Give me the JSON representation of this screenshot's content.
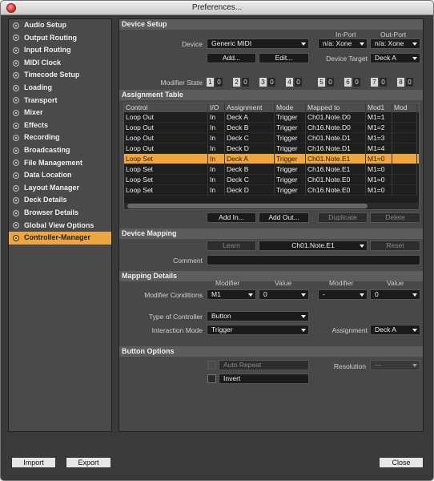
{
  "window": {
    "title": "Preferences..."
  },
  "sidebar": {
    "items": [
      {
        "label": "Audio Setup"
      },
      {
        "label": "Output Routing"
      },
      {
        "label": "Input Routing"
      },
      {
        "label": "MIDI Clock"
      },
      {
        "label": "Timecode Setup"
      },
      {
        "label": "Loading"
      },
      {
        "label": "Transport"
      },
      {
        "label": "Mixer"
      },
      {
        "label": "Effects"
      },
      {
        "label": "Recording"
      },
      {
        "label": "Broadcasting"
      },
      {
        "label": "File Management"
      },
      {
        "label": "Data Location"
      },
      {
        "label": "Layout Manager"
      },
      {
        "label": "Deck Details"
      },
      {
        "label": "Browser Details"
      },
      {
        "label": "Global View Options"
      },
      {
        "label": "Controller-Manager"
      }
    ],
    "active_label": "Controller-Manager"
  },
  "device_setup": {
    "header": "Device Setup",
    "device_label": "Device",
    "device_value": "Generic MIDI",
    "in_port_label": "In-Port",
    "in_port_value": "n/a: Xone",
    "out_port_label": "Out-Port",
    "out_port_value": "n/a: Xone",
    "add_label": "Add...",
    "edit_label": "Edit...",
    "device_target_label": "Device Target",
    "device_target_value": "Deck A",
    "modifier_state_label": "Modifier State",
    "modifiers": [
      {
        "num": "1",
        "val": "0"
      },
      {
        "num": "2",
        "val": "0"
      },
      {
        "num": "3",
        "val": "0"
      },
      {
        "num": "4",
        "val": "0"
      },
      {
        "num": "5",
        "val": "0"
      },
      {
        "num": "6",
        "val": "0"
      },
      {
        "num": "7",
        "val": "0"
      },
      {
        "num": "8",
        "val": "0"
      }
    ]
  },
  "assignment_table": {
    "header": "Assignment Table",
    "columns": [
      "Control",
      "I/O",
      "Assignment",
      "Mode",
      "Mapped to",
      "Mod1",
      "Mod"
    ],
    "rows": [
      [
        "Loop Out",
        "In",
        "Deck A",
        "Trigger",
        "Ch01.Note.D0",
        "M1=1"
      ],
      [
        "Loop Out",
        "In",
        "Deck B",
        "Trigger",
        "Ch16.Note.D0",
        "M1=2"
      ],
      [
        "Loop Out",
        "In",
        "Deck C",
        "Trigger",
        "Ch01.Note.D1",
        "M1=3"
      ],
      [
        "Loop Out",
        "In",
        "Deck D",
        "Trigger",
        "Ch16.Note.D1",
        "M1=4"
      ],
      [
        "Loop Set",
        "In",
        "Deck A",
        "Trigger",
        "Ch01.Note.E1",
        "M1=0"
      ],
      [
        "Loop Set",
        "In",
        "Deck B",
        "Trigger",
        "Ch16.Note.E1",
        "M1=0"
      ],
      [
        "Loop Set",
        "In",
        "Deck C",
        "Trigger",
        "Ch01.Note.E0",
        "M1=0"
      ],
      [
        "Loop Set",
        "In",
        "Deck D",
        "Trigger",
        "Ch16.Note.E0",
        "M1=0"
      ]
    ],
    "selected_row": 4,
    "add_in_label": "Add In...",
    "add_out_label": "Add Out...",
    "duplicate_label": "Duplicate",
    "delete_label": "Delete"
  },
  "device_mapping": {
    "header": "Device Mapping",
    "learn_label": "Learn",
    "mapped_value": "Ch01.Note.E1",
    "reset_label": "Reset",
    "comment_label": "Comment",
    "comment_value": ""
  },
  "mapping_details": {
    "header": "Mapping Details",
    "modifier_conditions_label": "Modifier Conditions",
    "modifier_col_label": "Modifier",
    "value_col_label": "Value",
    "mod1_value": "M1",
    "val1_value": "0",
    "mod2_value": "-",
    "val2_value": "0",
    "type_of_controller_label": "Type of Controller",
    "type_of_controller_value": "Button",
    "interaction_mode_label": "Interaction Mode",
    "interaction_mode_value": "Trigger",
    "assignment_label": "Assignment",
    "assignment_value": "Deck A"
  },
  "button_options": {
    "header": "Button Options",
    "auto_repeat_label": "Auto Repeat",
    "resolution_label": "Resolution",
    "resolution_value": "---",
    "invert_label": "Invert"
  },
  "footer": {
    "import_label": "Import",
    "export_label": "Export",
    "close_label": "Close"
  },
  "colors": {
    "accent": "#f0a63e",
    "panel": "#484848",
    "window": "#3a3a3a"
  }
}
